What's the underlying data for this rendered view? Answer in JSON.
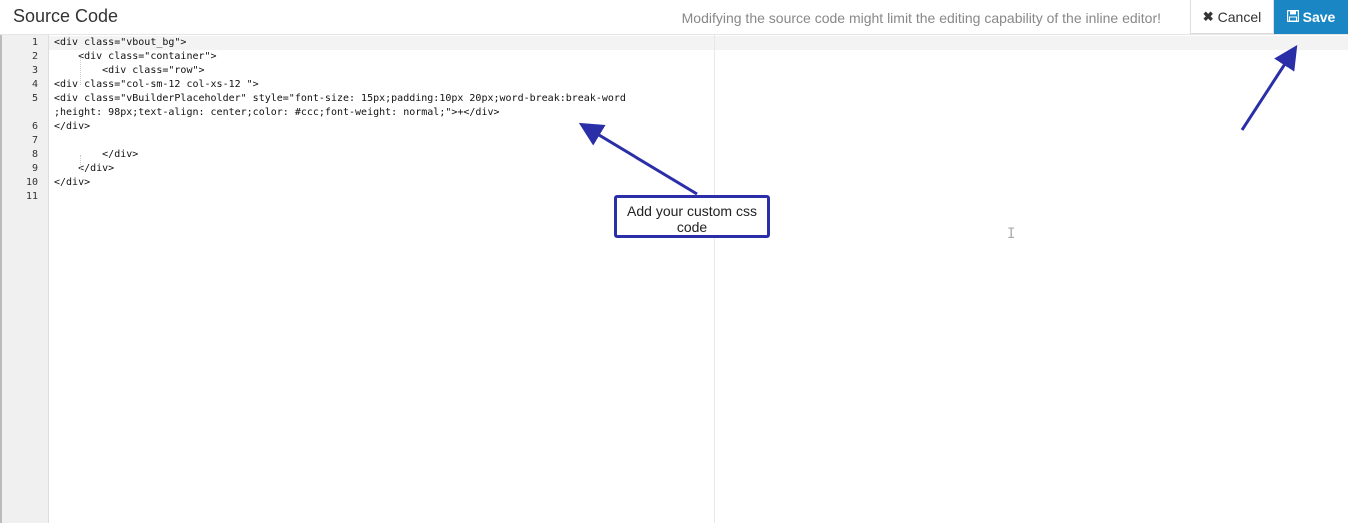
{
  "header": {
    "title": "Source Code",
    "warning": "Modifying the source code might limit the editing capability of the inline editor!",
    "cancel_label": "Cancel",
    "save_label": "Save",
    "cancel_icon": "close-icon",
    "save_icon": "floppy-disk-icon"
  },
  "editor": {
    "line_numbers": [
      "1",
      "2",
      "3",
      "4",
      "5",
      "",
      "6",
      "7",
      "8",
      "9",
      "10",
      "11"
    ],
    "lines": [
      "<div class=\"vbout_bg\">",
      "    <div class=\"container\">",
      "        <div class=\"row\">",
      "<div class=\"col-sm-12 col-xs-12 \">",
      "<div class=\"vBuilderPlaceholder\" style=\"font-size: 15px;padding:10px 20px;word-break:break-word",
      ";height: 98px;text-align: center;color: #ccc;font-weight: normal;\">+</div>",
      "</div>",
      "",
      "        </div>",
      "    </div>",
      "</div>",
      ""
    ]
  },
  "annotation": {
    "callout_text": "Add your custom css code",
    "color": "#2a2fa8"
  },
  "colors": {
    "save_bg": "#1a87c4",
    "gutter_bg": "#f0f0f0"
  }
}
